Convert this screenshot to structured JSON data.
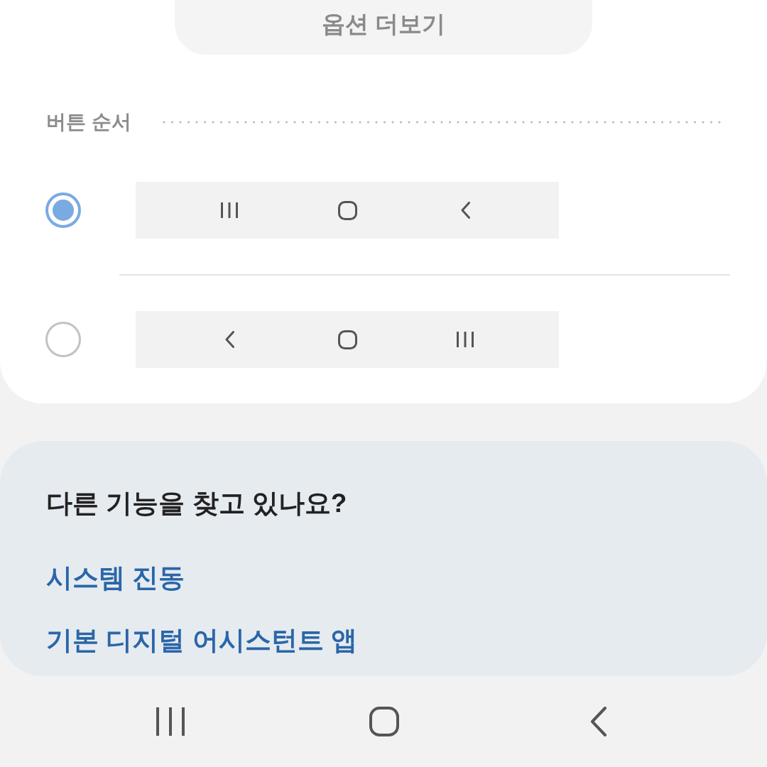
{
  "more_options_button": {
    "label": "옵션 더보기"
  },
  "button_order": {
    "label": "버튼 순서",
    "options": [
      {
        "selected": true,
        "buttons": [
          {
            "kind": "recents"
          },
          {
            "kind": "home"
          },
          {
            "kind": "back"
          }
        ]
      },
      {
        "selected": false,
        "buttons": [
          {
            "kind": "back"
          },
          {
            "kind": "home"
          },
          {
            "kind": "recents"
          }
        ]
      }
    ]
  },
  "suggestions": {
    "title": "다른 기능을 찾고 있나요?",
    "links": [
      "시스템 진동",
      "기본 디지털 어시스턴트 앱"
    ]
  },
  "nav_bar": {
    "buttons": [
      {
        "kind": "recents"
      },
      {
        "kind": "home"
      },
      {
        "kind": "back"
      }
    ]
  }
}
